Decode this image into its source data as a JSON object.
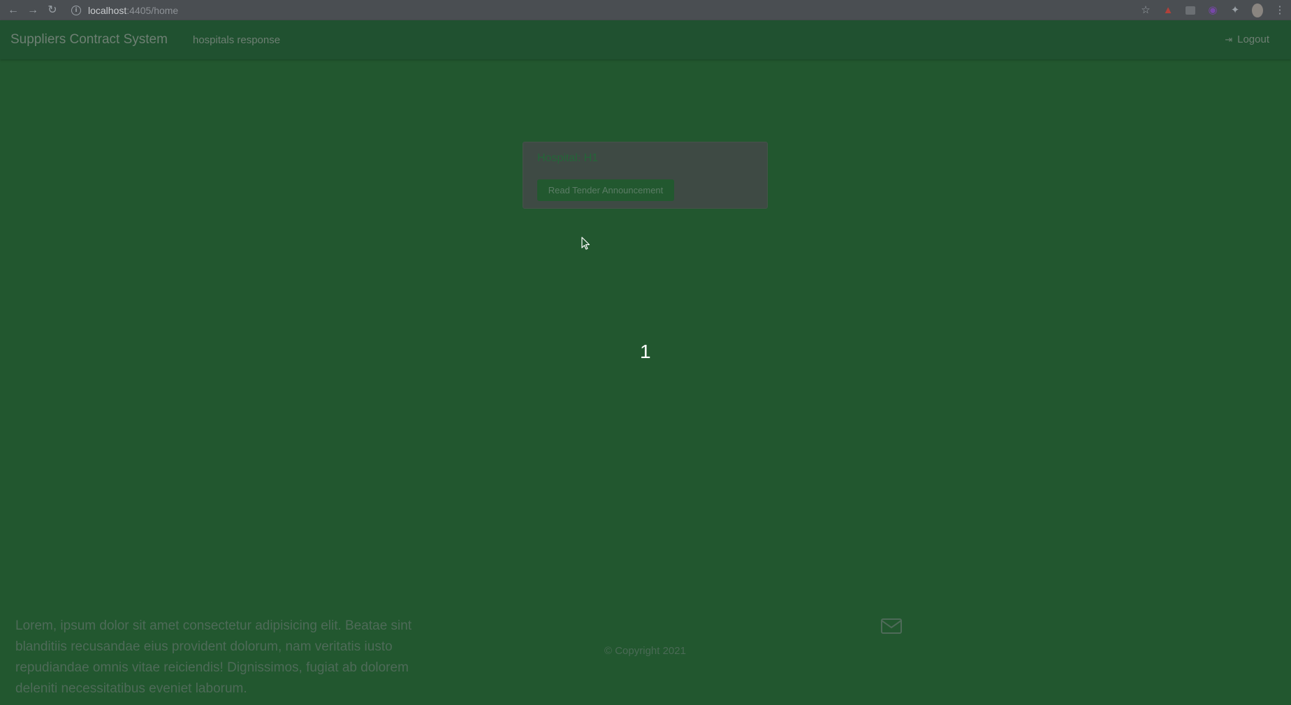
{
  "browser": {
    "url_host": "localhost",
    "url_path": ":4405/home",
    "back_icon": "←",
    "forward_icon": "→",
    "reload_icon": "↻",
    "star_icon": "☆",
    "extensions_icon": "✦",
    "menu_icon": "⋮"
  },
  "navbar": {
    "brand": "Suppliers Contract System",
    "link": "hospitals response",
    "logout_label": "Logout",
    "logout_icon": "⇥"
  },
  "card": {
    "title": "Hospital: H1",
    "button_label": "Read Tender Announcement"
  },
  "pagination": {
    "current_page": "1"
  },
  "footer": {
    "text": "Lorem, ipsum dolor sit amet consectetur adipisicing elit. Beatae sint blanditiis recusandae eius provident dolorum, nam veritatis iusto repudiandae omnis vitae reiciendis! Dignissimos, fugiat ab dolorem deleniti necessitatibus eveniet laborum.",
    "copyright": "© Copyright 2021"
  },
  "colors": {
    "page_background": "#22572f",
    "navbar_background": "#205130",
    "card_background": "#3e4a44",
    "button_background": "#22582f"
  }
}
